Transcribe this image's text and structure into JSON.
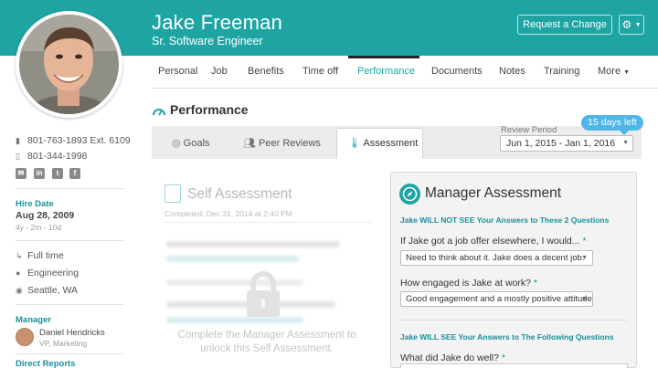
{
  "employee": {
    "name": "Jake Freeman",
    "title": "Sr. Software Engineer"
  },
  "header": {
    "request_change_label": "Request a Change",
    "settings_icon": "gear-icon"
  },
  "nav": {
    "tabs": [
      "Personal",
      "Job",
      "Benefits",
      "Time off",
      "Performance",
      "Documents",
      "Notes",
      "Training",
      "More"
    ],
    "active": "Performance"
  },
  "sidebar": {
    "phone_work": "801-763-1893",
    "phone_ext": "Ext. 6109",
    "phone_mobile": "801-344-1998",
    "social_icons": [
      "email-icon",
      "linkedin-icon",
      "twitter-icon",
      "facebook-icon"
    ],
    "hire_date_label": "Hire Date",
    "hire_date": "Aug 28, 2009",
    "tenure": "4y - 2m - 10d",
    "employment_type": "Full time",
    "department": "Engineering",
    "location": "Seattle, WA",
    "manager_label": "Manager",
    "manager_name": "Daniel Hendricks",
    "manager_title": "VP, Marketing",
    "direct_reports_label": "Direct Reports"
  },
  "performance": {
    "section_title": "Performance",
    "subtabs": [
      "Goals",
      "Peer Reviews",
      "Assessment"
    ],
    "active_subtab": "Assessment",
    "review_period_label": "Review Period",
    "review_period_value": "Jun 1, 2015 - Jan 1, 2016",
    "days_left": "15 days left"
  },
  "self_assessment": {
    "title": "Self Assessment",
    "completed_label": "Completed:",
    "completed_value": "Dec 31, 2014 at 2:40 PM",
    "locked_message_line1": "Complete the Manager Assessment to",
    "locked_message_line2": "unlock this Self Assessment."
  },
  "manager_assessment": {
    "title": "Manager Assessment",
    "section1": "Jake WILL NOT SEE Your Answers to These 2 Questions",
    "q1": "If Jake got a job offer elsewhere, I would...",
    "q1_answer": "Need to think about it. Jake does a decent job.",
    "q2": "How engaged is Jake at work?",
    "q2_answer": "Good engagement and a mostly positive attitude.",
    "section2": "Jake WILL SEE Your Answers to The Following Questions",
    "q3": "What did Jake do well?",
    "required_marker": "*"
  },
  "colors": {
    "brand_teal": "#1fa4a4",
    "badge_blue": "#4fb6e6"
  }
}
